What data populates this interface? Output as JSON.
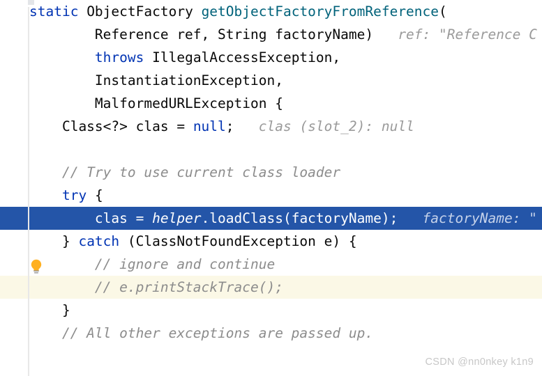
{
  "editor": {
    "watermark": "CSDN @nn0nkey k1n9",
    "colors": {
      "background": "#ffffff",
      "keyword": "#0033b3",
      "method": "#00627a",
      "comment": "#8c8c8c",
      "inlay_hint": "#9a9a9a",
      "selection": "#2455a8",
      "warning_line": "#fbf8e6",
      "gutter_rule": "#e8e8e8",
      "bulb": "#ffb020"
    },
    "gutter": {
      "intention_bulb_icon": "lightbulb-icon"
    },
    "lines": [
      {
        "n": 1,
        "state": "normal",
        "tokens": [
          {
            "t": "static",
            "c": "kw"
          },
          {
            "t": " ObjectFactory ",
            "c": "plain"
          },
          {
            "t": "getObjectFactoryFromReference",
            "c": "meth"
          },
          {
            "t": "(",
            "c": "plain"
          }
        ]
      },
      {
        "n": 2,
        "state": "normal",
        "tokens": [
          {
            "t": "        Reference ref, String factoryName)",
            "c": "plain"
          },
          {
            "t": "   ref: \"Reference C",
            "c": "hint"
          }
        ]
      },
      {
        "n": 3,
        "state": "normal",
        "tokens": [
          {
            "t": "        ",
            "c": "plain"
          },
          {
            "t": "throws",
            "c": "kw"
          },
          {
            "t": " IllegalAccessException,",
            "c": "plain"
          }
        ]
      },
      {
        "n": 4,
        "state": "normal",
        "tokens": [
          {
            "t": "        InstantiationException,",
            "c": "plain"
          }
        ]
      },
      {
        "n": 5,
        "state": "normal",
        "tokens": [
          {
            "t": "        MalformedURLException {",
            "c": "plain"
          }
        ]
      },
      {
        "n": 6,
        "state": "normal",
        "tokens": [
          {
            "t": "    Class<?> clas = ",
            "c": "plain"
          },
          {
            "t": "null",
            "c": "kw"
          },
          {
            "t": ";",
            "c": "plain"
          },
          {
            "t": "   clas (slot_2): null",
            "c": "hint"
          }
        ]
      },
      {
        "n": 7,
        "state": "normal",
        "tokens": [
          {
            "t": "",
            "c": "plain"
          }
        ]
      },
      {
        "n": 8,
        "state": "normal",
        "tokens": [
          {
            "t": "    // Try to use current class loader",
            "c": "cmt"
          }
        ]
      },
      {
        "n": 9,
        "state": "normal",
        "tokens": [
          {
            "t": "    ",
            "c": "plain"
          },
          {
            "t": "try",
            "c": "kw"
          },
          {
            "t": " {",
            "c": "plain"
          }
        ]
      },
      {
        "n": 10,
        "state": "selected",
        "tokens": [
          {
            "t": "        clas = ",
            "c": "plain"
          },
          {
            "t": "helper",
            "c": "fld"
          },
          {
            "t": ".loadClass(factoryName);",
            "c": "plain"
          },
          {
            "t": "   factoryName: \"",
            "c": "hint"
          }
        ]
      },
      {
        "n": 11,
        "state": "normal",
        "tokens": [
          {
            "t": "    } ",
            "c": "plain"
          },
          {
            "t": "catch",
            "c": "kw"
          },
          {
            "t": " (ClassNotFoundException e) {",
            "c": "plain"
          }
        ]
      },
      {
        "n": 12,
        "state": "normal",
        "tokens": [
          {
            "t": "        // ignore and continue",
            "c": "cmt"
          }
        ]
      },
      {
        "n": 13,
        "state": "warning",
        "tokens": [
          {
            "t": "        // e.printStackTrace();",
            "c": "cmt"
          }
        ]
      },
      {
        "n": 14,
        "state": "normal",
        "tokens": [
          {
            "t": "    }",
            "c": "plain"
          }
        ]
      },
      {
        "n": 15,
        "state": "normal",
        "tokens": [
          {
            "t": "    // All other exceptions are passed up.",
            "c": "cmt"
          }
        ]
      },
      {
        "n": 16,
        "state": "normal",
        "tokens": [
          {
            "t": "",
            "c": "plain"
          }
        ]
      }
    ]
  }
}
